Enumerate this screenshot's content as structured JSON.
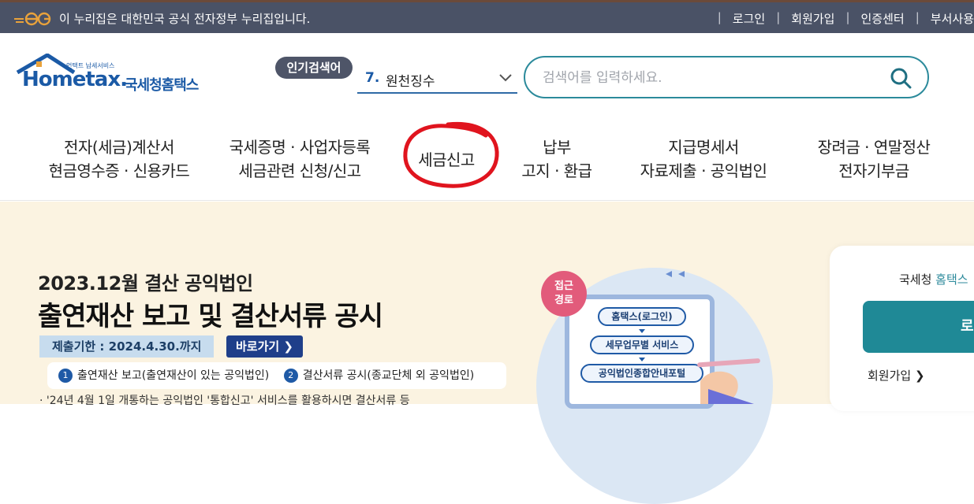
{
  "govbar": {
    "notice": "이 누리집은 대한민국 공식 전자정부 누리집입니다.",
    "links": [
      "로그인",
      "회원가입",
      "인증센터",
      "부서사용"
    ]
  },
  "header": {
    "logo_word": "Hometax.",
    "logo_small": "언택트 납세서비스",
    "logo_korean": "국세청홈택스",
    "popular_badge": "인기검색어",
    "popular_number": "7.",
    "popular_term": "원천징수",
    "search_placeholder": "검색어를 입력하세요."
  },
  "nav": {
    "items": [
      {
        "line1": "전자(세금)계산서",
        "line2": "현금영수증 · 신용카드"
      },
      {
        "line1": "국세증명 · 사업자등록",
        "line2": "세금관련 신청/신고"
      },
      {
        "line1": "세금신고",
        "line2": ""
      },
      {
        "line1": "납부",
        "line2": "고지 · 환급"
      },
      {
        "line1": "지급명세서",
        "line2": "자료제출 · 공익법인"
      },
      {
        "line1": "장려금 · 연말정산",
        "line2": "전자기부금"
      }
    ]
  },
  "banner": {
    "subtitle": "2023.12월 결산 공익법인",
    "title": "출연재산 보고 및 결산서류 공시",
    "deadline": "제출기한 : 2024.4.30.까지",
    "goto_label": "바로가기 ❯",
    "step1_num": "1",
    "step1": "출연재산 보고(출연재산이 있는 공익법인)",
    "step2_num": "2",
    "step2": "결산서류 공시(종교단체 외 공익법인)",
    "note": "· '24년 4월 1일 개통하는 공익법인 '통합신고' 서비스를 활용하시면 결산서류 등",
    "illus_tag": "접근\n경로",
    "illus_steps": [
      "홈택스(로그인)",
      "세무업무별 서비스",
      "공익법인종합안내포털"
    ]
  },
  "login_card": {
    "text_prefix": "국세청 ",
    "text_accent": "홈택스",
    "button": "로",
    "join": "회원가입 ❯"
  },
  "colors": {
    "govbar": "#4a5266",
    "brand_blue": "#1b5aa6",
    "search_border": "#2b8a9b",
    "banner_bg": "#fbf3e1",
    "annotation_red": "#e0141e"
  }
}
